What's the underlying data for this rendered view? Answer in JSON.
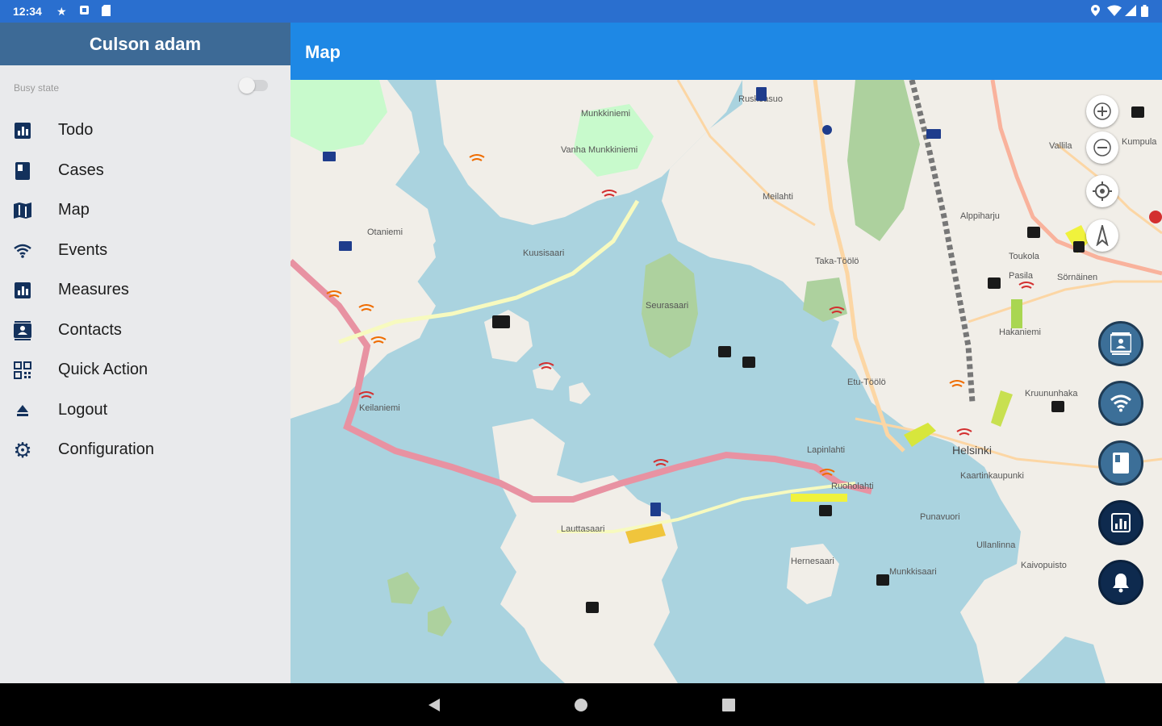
{
  "status_bar": {
    "time": "12:34"
  },
  "drawer": {
    "user_name": "Culson adam",
    "busy_state_label": "Busy state",
    "busy_state_on": false,
    "items": [
      {
        "label": "Todo",
        "icon": "chart-icon"
      },
      {
        "label": "Cases",
        "icon": "book-icon"
      },
      {
        "label": "Map",
        "icon": "map-icon"
      },
      {
        "label": "Events",
        "icon": "wifi-icon"
      },
      {
        "label": "Measures",
        "icon": "chart-icon"
      },
      {
        "label": "Contacts",
        "icon": "contacts-icon"
      },
      {
        "label": "Quick Action",
        "icon": "qr-code-icon"
      },
      {
        "label": "Logout",
        "icon": "eject-icon"
      },
      {
        "label": "Configuration",
        "icon": "gear-icon"
      }
    ]
  },
  "app_bar": {
    "title": "Map"
  },
  "map": {
    "places": [
      "Ruskeasuo",
      "Munkkiniemi",
      "Vanha Munkkiniemi",
      "Otaniemi",
      "Kuusisaari",
      "Meilahti",
      "Alppiharju",
      "Toukola",
      "Sörnäinen",
      "Pasila",
      "Taka-Töölö",
      "Etu-Töölö",
      "Hakaniemi",
      "Lauttasaari",
      "Helsinki",
      "Kaartinkaupunki",
      "Punavuori",
      "Ullanlinna",
      "Kaivopuisto",
      "Hernesaari",
      "Munkkisaari",
      "Lapinlahti",
      "Seurasaari",
      "Keilaniemi",
      "Vallila",
      "Kumpula",
      "Ruoholahti",
      "Kruununhaka"
    ],
    "accent_color": "#1e88e5",
    "fabs": [
      "contacts-icon",
      "wifi-icon",
      "book-icon",
      "chart-icon",
      "bell-icon"
    ]
  },
  "nav_bar": {
    "buttons": [
      "back-icon",
      "home-icon",
      "recents-icon"
    ]
  }
}
